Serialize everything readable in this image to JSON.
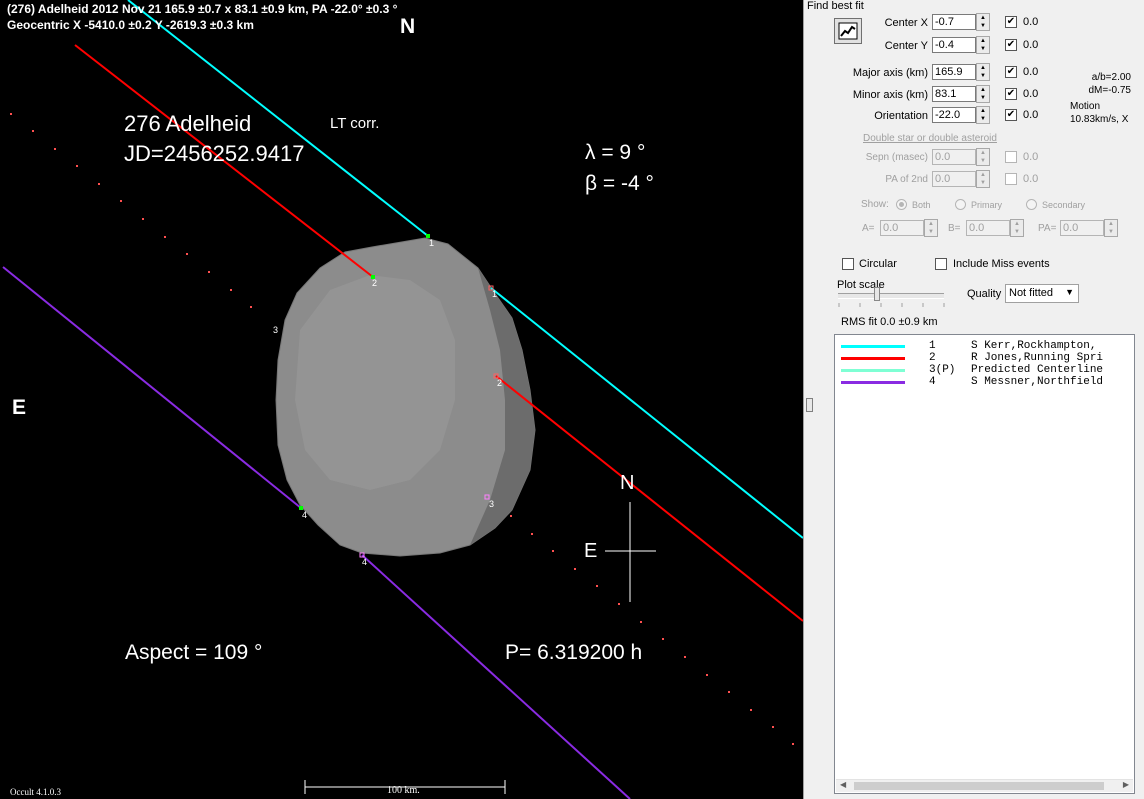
{
  "plot": {
    "header_line1": "(276) Adelheid  2012 Nov 21   165.9 ±0.7 x 83.1 ±0.9 km, PA -22.0° ±0.3 °",
    "header_line2": "Geocentric  X  -5410.0 ±0.2  Y -2619.3 ±0.3 km",
    "north_top": "N",
    "east_left": "E",
    "asteroid_name": "276 Adelheid",
    "jd": "JD=2456252.9417",
    "lt_corr": "LT corr.",
    "lambda": "λ =   9 °",
    "beta": "β =  -4 °",
    "aspect": "Aspect = 109 °",
    "period": "P= 6.319200 h",
    "compass_n": "N",
    "compass_e": "E",
    "scale_label": "100 km.",
    "version": "Occult 4.1.0.3",
    "chord_labels": [
      "1",
      "2",
      "3",
      "4",
      "1",
      "2",
      "3",
      "4"
    ]
  },
  "panel": {
    "group_title": "Find best fit",
    "fit_button_icon": "chart-fit-icon",
    "center_x": {
      "label": "Center X",
      "value": "-0.7",
      "fix": "0.0"
    },
    "center_y": {
      "label": "Center Y",
      "value": "-0.4",
      "fix": "0.0"
    },
    "major_axis": {
      "label": "Major axis (km)",
      "value": "165.9",
      "fix": "0.0"
    },
    "minor_axis": {
      "label": "Minor axis (km)",
      "value": "83.1",
      "fix": "0.0"
    },
    "orientation": {
      "label": "Orientation",
      "value": "-22.0",
      "fix": "0.0"
    },
    "ab_ratio": "a/b=2.00",
    "dm": "dM=-0.75",
    "motion_label": "Motion",
    "motion_value": "10.83km/s, X",
    "double_star_label": "Double star  or  double asteroid",
    "sepn": {
      "label": "Sepn (masec)",
      "value": "0.0",
      "fix": "0.0"
    },
    "pa2nd": {
      "label": "PA of 2nd",
      "value": "0.0",
      "fix": "0.0"
    },
    "show_label": "Show:",
    "show_options": [
      "Both",
      "Primary",
      "Secondary"
    ],
    "a_label": "A=",
    "a_value": "0.0",
    "b_label": "B=",
    "b_value": "0.0",
    "pa_label": "PA=",
    "pa_value": "0.0",
    "circular_label": "Circular",
    "include_miss_label": "Include Miss events",
    "plot_scale_label": "Plot scale",
    "quality_label": "Quality",
    "quality_value": "Not fitted",
    "rms_fit": "RMS fit  0.0 ±0.9 km",
    "legend": [
      {
        "num": "1",
        "name": "S Kerr,Rockhampton,",
        "color": "#00ffff"
      },
      {
        "num": "2",
        "name": "R Jones,Running Spri",
        "color": "#ff0000"
      },
      {
        "num": "3(P)",
        "name": "Predicted Centerline",
        "color": "#7fffd4"
      },
      {
        "num": "4",
        "name": "S Messner,Northfield",
        "color": "#8a2be2"
      }
    ]
  }
}
